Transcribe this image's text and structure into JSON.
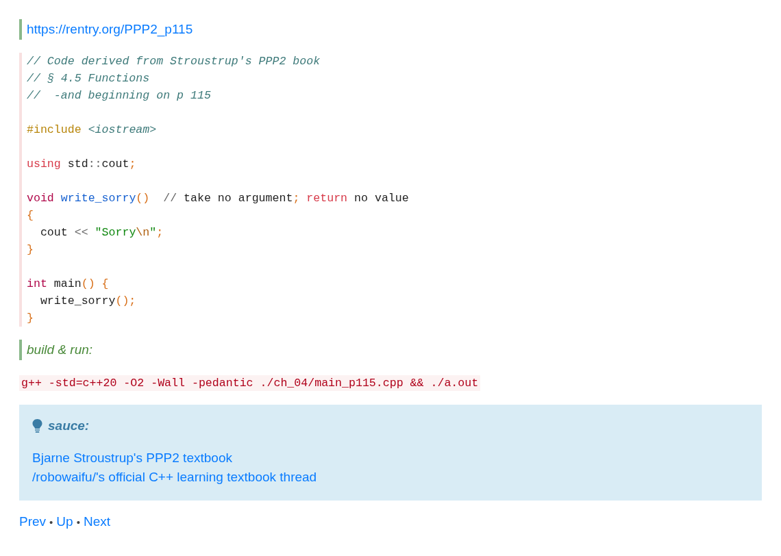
{
  "source_link": "https://rentry.org/PPP2_p115",
  "code_blocks": [
    [
      [
        {
          "kind": "comment",
          "text": "// Code derived from Stroustrup's PPP2 book"
        }
      ],
      [
        {
          "kind": "comment",
          "text": "// § 4.5 Functions"
        }
      ],
      [
        {
          "kind": "comment",
          "text": "//  -and beginning on p 115"
        }
      ]
    ],
    [
      [
        {
          "kind": "preproc",
          "text": "#include"
        },
        {
          "kind": "header",
          "text": " <iostream>"
        }
      ]
    ],
    [
      [
        {
          "kind": "keyword",
          "text": "using"
        },
        {
          "kind": "plain",
          "text": " std"
        },
        {
          "kind": "operator",
          "text": "::"
        },
        {
          "kind": "plain",
          "text": "cout"
        },
        {
          "kind": "punct",
          "text": ";"
        }
      ]
    ],
    [
      [
        {
          "kind": "type",
          "text": "void"
        },
        {
          "kind": "function",
          "text": " write_sorry"
        },
        {
          "kind": "punct",
          "text": "()"
        },
        {
          "kind": "operator",
          "text": "  //"
        },
        {
          "kind": "plain",
          "text": " take no argument"
        },
        {
          "kind": "punct",
          "text": ";"
        },
        {
          "kind": "keyword",
          "text": " return"
        },
        {
          "kind": "plain",
          "text": " no value"
        }
      ],
      [
        {
          "kind": "punct",
          "text": "{"
        }
      ],
      [
        {
          "kind": "plain",
          "text": "  cout "
        },
        {
          "kind": "operator",
          "text": "<<"
        },
        {
          "kind": "string",
          "text": " \"Sorry"
        },
        {
          "kind": "escape",
          "text": "\\n"
        },
        {
          "kind": "string",
          "text": "\""
        },
        {
          "kind": "punct",
          "text": ";"
        }
      ],
      [
        {
          "kind": "punct",
          "text": "}"
        }
      ]
    ],
    [
      [
        {
          "kind": "type",
          "text": "int"
        },
        {
          "kind": "plain",
          "text": " main"
        },
        {
          "kind": "punct",
          "text": "() {"
        }
      ],
      [
        {
          "kind": "plain",
          "text": "  write_sorry"
        },
        {
          "kind": "punct",
          "text": "();"
        }
      ],
      [
        {
          "kind": "punct",
          "text": "}"
        }
      ]
    ]
  ],
  "build_heading": "build & run:",
  "command": "g++ -std=c++20 -O2 -Wall -pedantic ./ch_04/main_p115.cpp && ./a.out",
  "note": {
    "title": "sauce:",
    "links": [
      "Bjarne Stroustrup's PPP2 textbook",
      "/robowaifu/'s official C++ learning textbook thread"
    ]
  },
  "nav": [
    {
      "kind": "link",
      "text": "Prev"
    },
    {
      "kind": "separator",
      "text": "•"
    },
    {
      "kind": "link",
      "text": "Up"
    },
    {
      "kind": "separator",
      "text": "•"
    },
    {
      "kind": "link",
      "text": "Next"
    }
  ]
}
